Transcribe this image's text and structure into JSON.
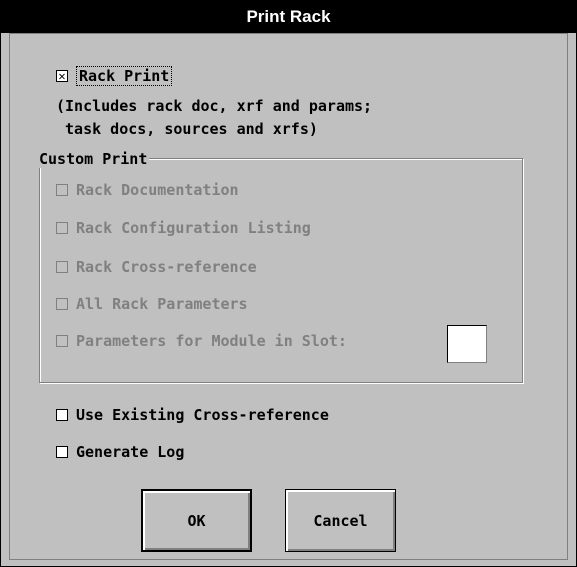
{
  "window": {
    "title": "Print Rack"
  },
  "rack_print": {
    "label": "Rack Print",
    "checked": true
  },
  "rack_print_note": [
    "(Includes rack doc, xrf and params;",
    " task docs, sources and xrfs)"
  ],
  "custom_print": {
    "legend": "Custom Print",
    "items": [
      {
        "label": "Rack Documentation"
      },
      {
        "label": "Rack Configuration Listing"
      },
      {
        "label": "Rack Cross-reference"
      },
      {
        "label": "All Rack Parameters"
      },
      {
        "label": "Parameters for Module in Slot:"
      }
    ],
    "slot_value": ""
  },
  "options": [
    {
      "label": "Use Existing Cross-reference",
      "checked": false
    },
    {
      "label": "Generate Log",
      "checked": false
    }
  ],
  "buttons": {
    "ok": "OK",
    "cancel": "Cancel"
  },
  "icons": {
    "checked_mark": "✕"
  }
}
